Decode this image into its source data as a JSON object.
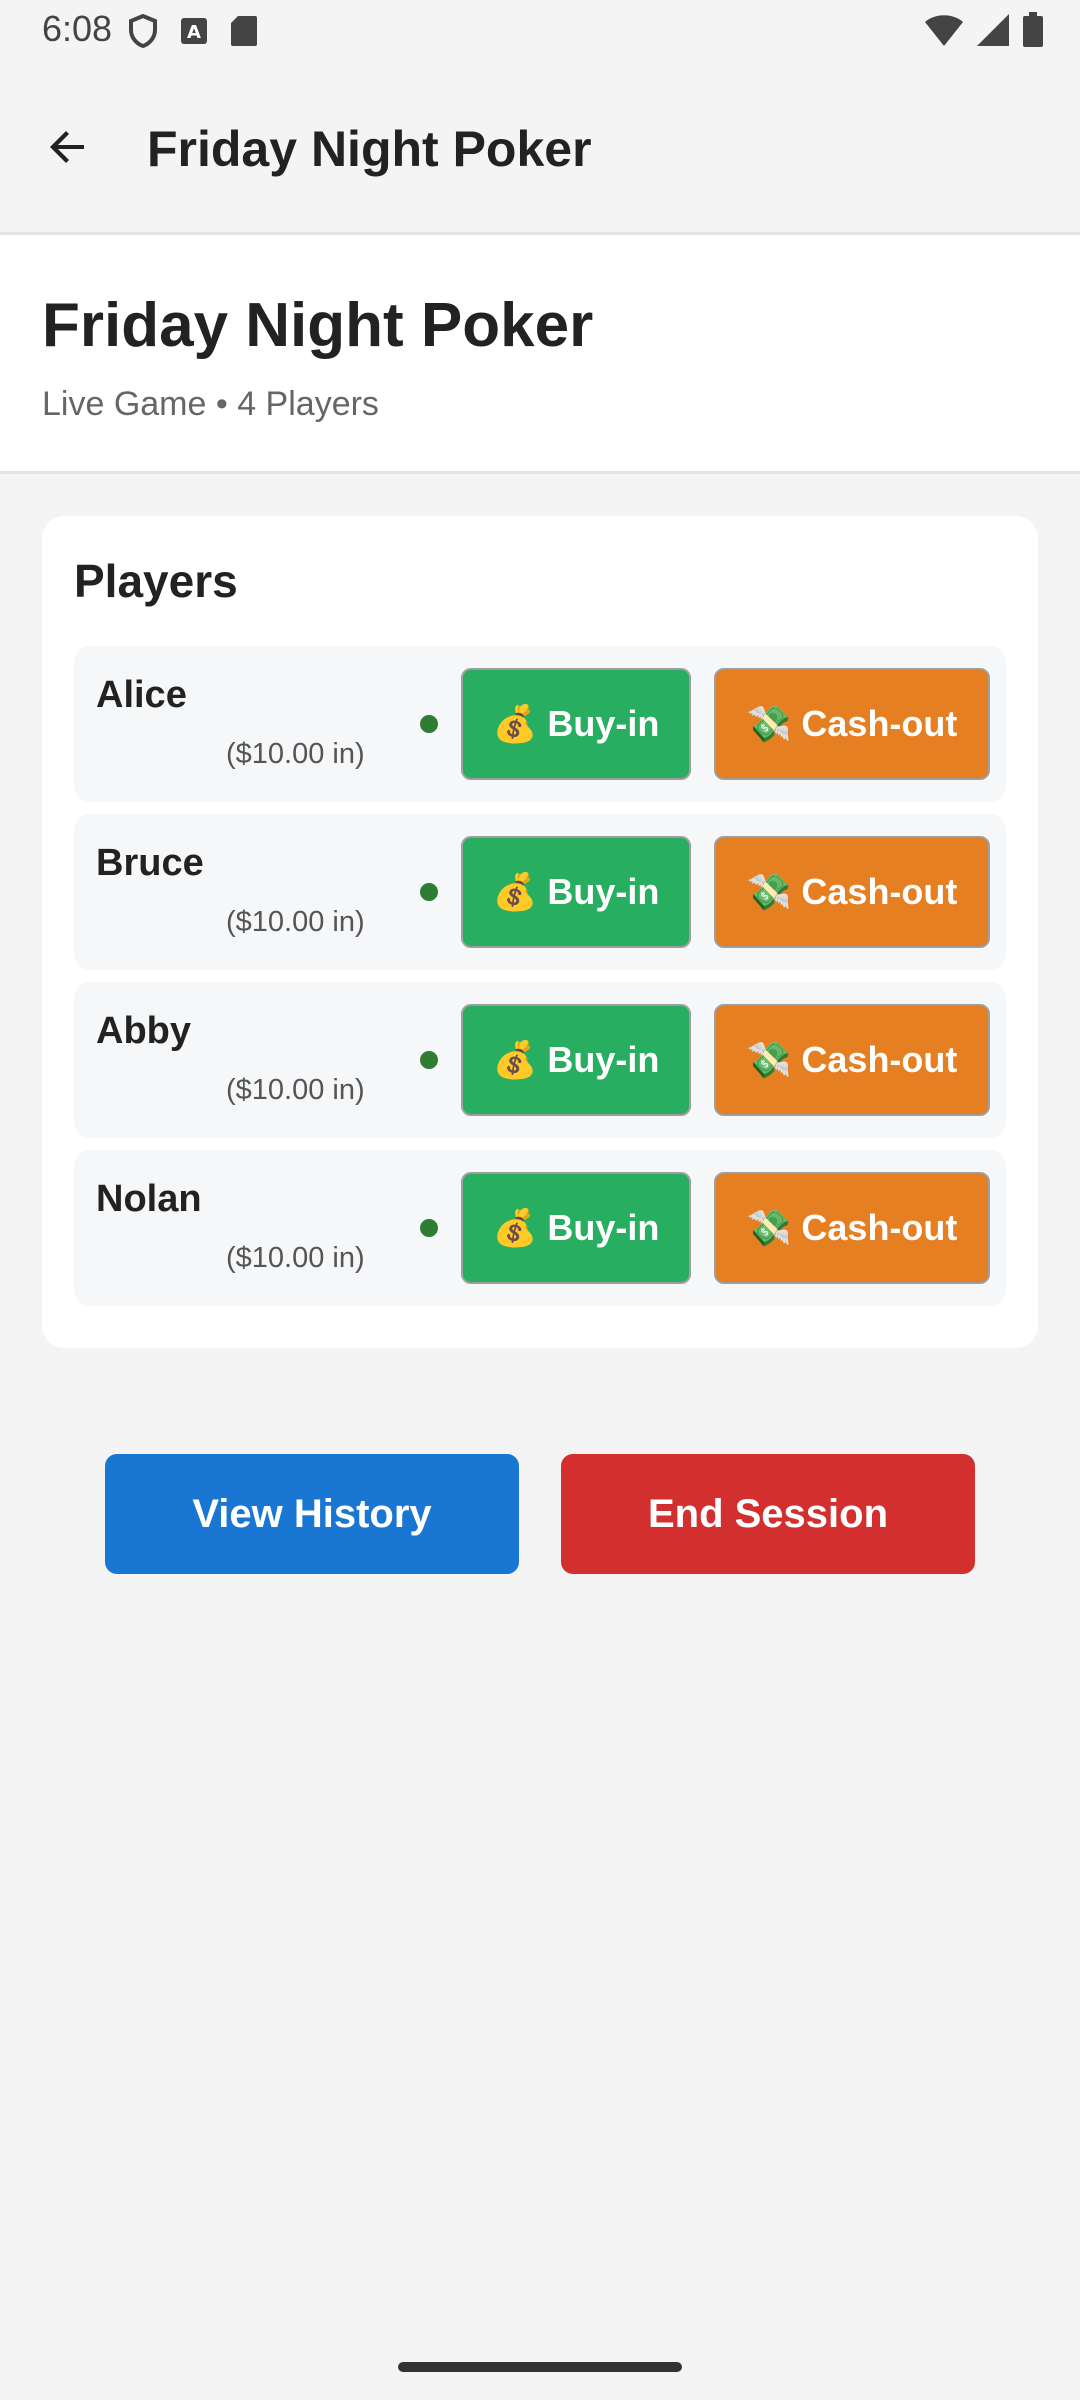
{
  "status_bar": {
    "time": "6:08",
    "icons_left": [
      "shield-icon",
      "text-a-icon",
      "sd-card-icon"
    ],
    "icons_right": [
      "wifi-icon",
      "signal-icon",
      "battery-icon"
    ]
  },
  "app_bar": {
    "title": "Friday Night Poker",
    "back_icon": "arrow-back-icon"
  },
  "header": {
    "title": "Friday Night Poker",
    "subtitle": "Live Game • 4 Players"
  },
  "players_section": {
    "heading": "Players",
    "players": [
      {
        "name": "Alice",
        "amount": "($10.00 in)"
      },
      {
        "name": "Bruce",
        "amount": "($10.00 in)"
      },
      {
        "name": "Abby",
        "amount": "($10.00 in)"
      },
      {
        "name": "Nolan",
        "amount": "($10.00 in)"
      }
    ],
    "buyin_emoji": "💰",
    "buyin_label": "Buy-in",
    "cashout_emoji": "💸",
    "cashout_label": "Cash-out"
  },
  "actions": {
    "history_label": "View History",
    "end_label": "End Session"
  },
  "colors": {
    "buyin": "#27ae60",
    "cashout": "#e67e22",
    "history": "#1976d2",
    "end": "#d32f2f",
    "active_dot": "#2e7d32"
  }
}
